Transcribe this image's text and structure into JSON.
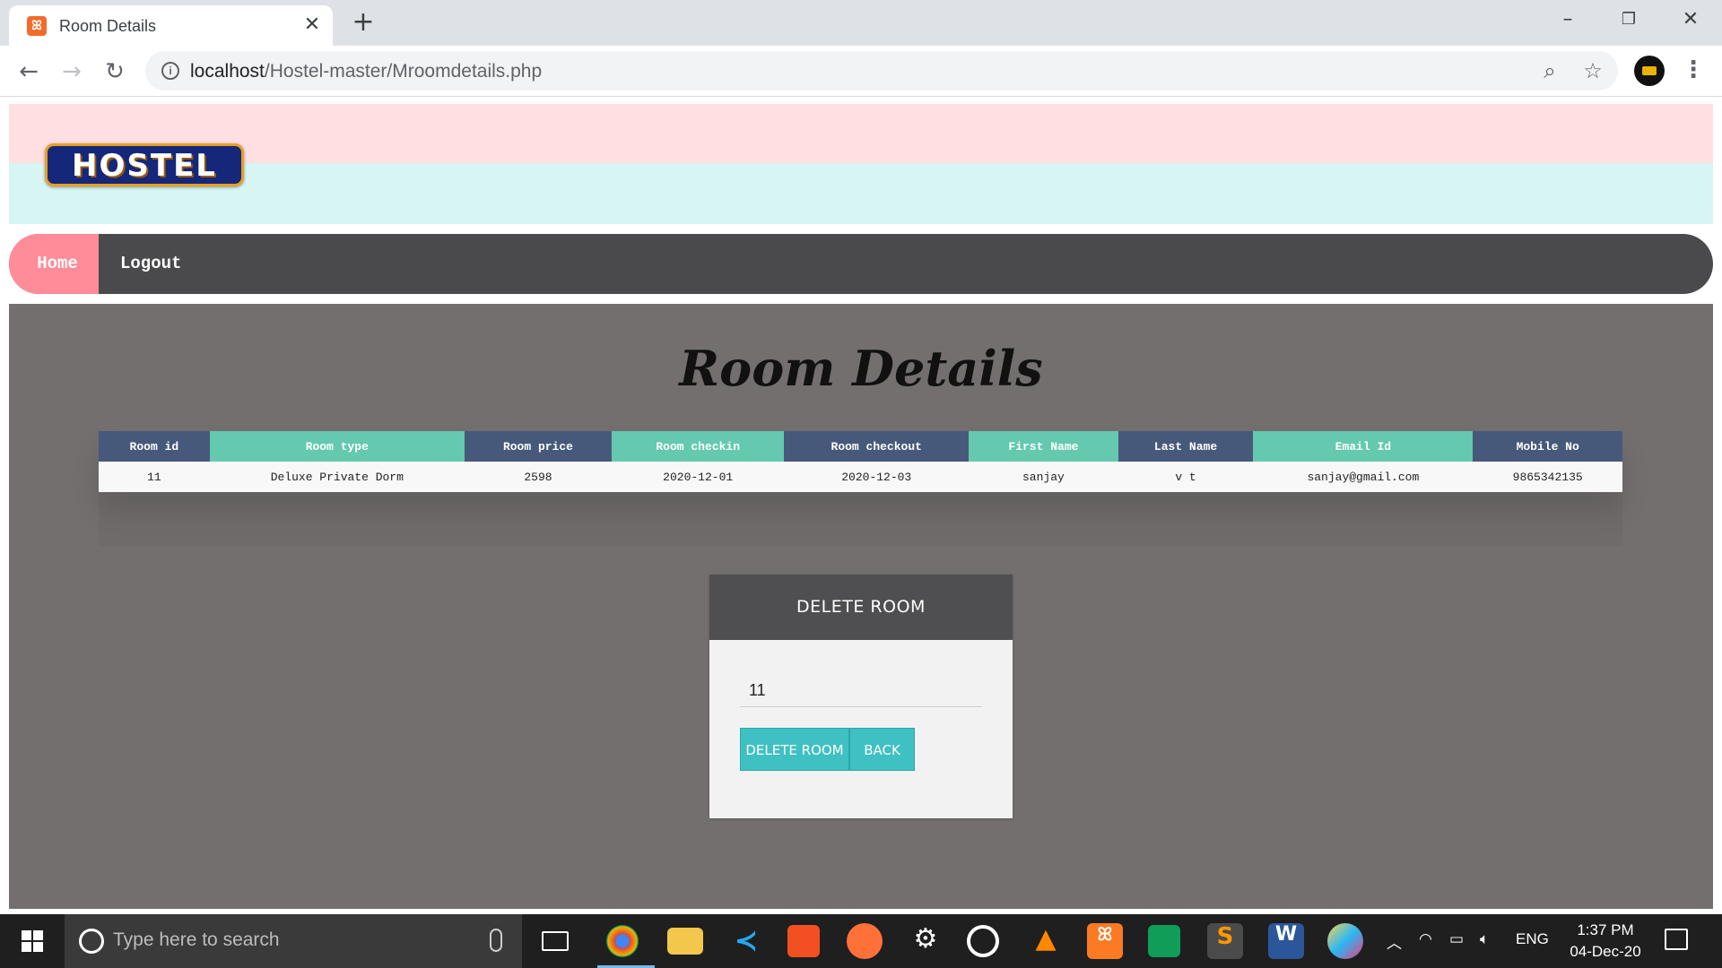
{
  "browser": {
    "tab_title": "Room Details",
    "url_host": "localhost",
    "url_path": "/Hostel-master/Mroomdetails.php"
  },
  "site": {
    "logo_text": "HOSTEL",
    "nav": {
      "home": "Home",
      "logout": "Logout"
    }
  },
  "main": {
    "title": "Room Details",
    "table": {
      "headers": [
        "Room id",
        "Room type",
        "Room price",
        "Room checkin",
        "Room checkout",
        "First Name",
        "Last Name",
        "Email Id",
        "Mobile No"
      ],
      "rows": [
        [
          "11",
          "Deluxe Private Dorm",
          "2598",
          "2020-12-01",
          "2020-12-03",
          "sanjay",
          "v t",
          "sanjay@gmail.com",
          "9865342135"
        ]
      ]
    },
    "form": {
      "heading": "DELETE ROOM",
      "room_id_value": "11",
      "delete_label": "DELETE ROOM",
      "back_label": "BACK"
    }
  },
  "taskbar": {
    "search_placeholder": "Type here to search",
    "lang": "ENG",
    "time": "1:37 PM",
    "date": "04-Dec-20"
  },
  "colors": {
    "header_pink": "#ffdfe1",
    "header_cyan": "#d6f5f3",
    "nav_dark": "#4a494b",
    "nav_home": "#ff8c98",
    "content_bg": "#736f6f",
    "th_dark": "#47597a",
    "th_teal": "#64c9ae",
    "button": "#3fc0c3"
  }
}
